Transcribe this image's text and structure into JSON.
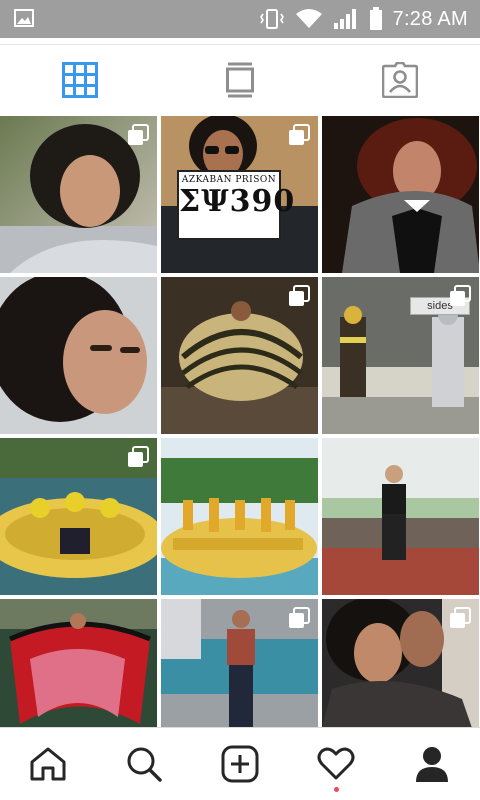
{
  "status_bar": {
    "time": "7:28 AM",
    "icons": [
      "image-icon",
      "vibrate-icon",
      "wifi-icon",
      "signal-icon",
      "battery-icon"
    ]
  },
  "tabs": [
    {
      "name": "grid-view",
      "icon": "grid-icon",
      "active": true,
      "color": "#3897f0"
    },
    {
      "name": "feed-view",
      "icon": "feed-icon",
      "active": false
    },
    {
      "name": "tagged-view",
      "icon": "tagged-person-icon",
      "active": false
    }
  ],
  "photos": {
    "sign_title": "AZKABAN PRISON",
    "sign_number": "ΣΨ390",
    "truck_text": "sides"
  },
  "bottom_nav": {
    "items": [
      "home-icon",
      "search-icon",
      "add-post-icon",
      "activity-heart-icon",
      "profile-icon"
    ],
    "notification_color": "#ed4956"
  }
}
